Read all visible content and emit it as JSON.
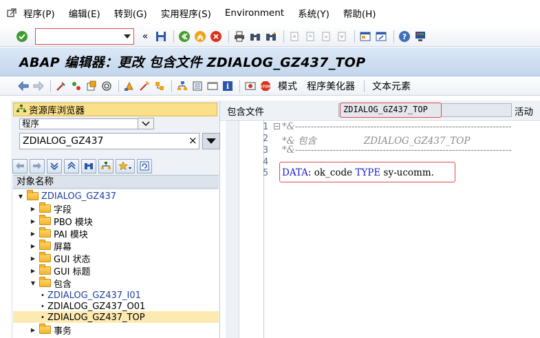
{
  "menu": {
    "items": [
      {
        "label": "程序(P)"
      },
      {
        "label": "编辑(E)"
      },
      {
        "label": "转到(G)"
      },
      {
        "label": "实用程序(S)"
      },
      {
        "label": "Environment"
      },
      {
        "label": "系统(Y)"
      },
      {
        "label": "帮助(H)"
      }
    ]
  },
  "toolbar": {
    "command_value": "",
    "collapse_glyph": "«"
  },
  "title": {
    "text": "ABAP 编辑器：更改 包含文件 ZDIALOG_GZ437_TOP"
  },
  "app_toolbar": {
    "pattern_label": "模式",
    "pretty_printer_label": "程序美化器",
    "text_elements_label": "文本元素"
  },
  "repository": {
    "title": "资源库浏览器",
    "object_type": "程序",
    "object_name": "ZDIALOG_GZ437",
    "clear_glyph": "×",
    "column_header": "对象名称",
    "tree": [
      {
        "label": "ZDIALOG_GZ437",
        "level": 0,
        "expanded": true
      },
      {
        "label": "字段",
        "level": 1,
        "expanded": false
      },
      {
        "label": "PBO 模块",
        "level": 1,
        "expanded": false
      },
      {
        "label": "PAI 模块",
        "level": 1,
        "expanded": false
      },
      {
        "label": "屏幕",
        "level": 1,
        "expanded": false
      },
      {
        "label": "GUI 状态",
        "level": 1,
        "expanded": false
      },
      {
        "label": "GUI 标题",
        "level": 1,
        "expanded": false
      },
      {
        "label": "包含",
        "level": 1,
        "expanded": true
      },
      {
        "label": "ZDIALOG_GZ437_I01",
        "level": 2
      },
      {
        "label": "ZDIALOG_GZ437_O01",
        "level": 2
      },
      {
        "label": "ZDIALOG_GZ437_TOP",
        "level": 2,
        "selected": true
      },
      {
        "label": "事务",
        "level": 1,
        "expanded": false
      }
    ]
  },
  "editor": {
    "include_label": "包含文件",
    "include_name": "ZDIALOG_GZ437_TOP",
    "status": "活动",
    "lines": [
      {
        "num": "1",
        "text": "*&---------------------------------------------------------------------"
      },
      {
        "num": "2",
        "text": "*& 包含                ZDIALOG_GZ437_TOP"
      },
      {
        "num": "3",
        "text": "*&---------------------------------------------------------------------"
      },
      {
        "num": "4",
        "text": ""
      },
      {
        "num": "5",
        "kw1": "DATA",
        "rest1": ": ok_code ",
        "kw2": "TYPE",
        "rest2": " sy-ucomm."
      }
    ]
  },
  "colors": {
    "highlight_border": "#e04848",
    "title_bg": "#c3d6ec",
    "repo_title_bg": "#fbe08a",
    "selected_row_bg": "#fdeab0",
    "keyword": "#1c1ccc",
    "comment": "#8b8b8b"
  }
}
